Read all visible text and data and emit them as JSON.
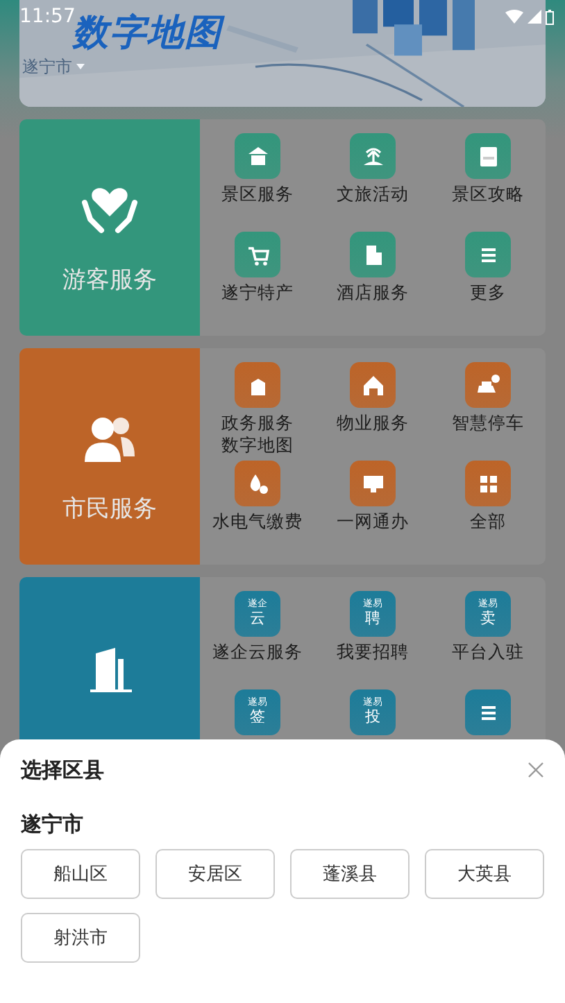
{
  "status_bar": {
    "time": "11:57"
  },
  "banner": {
    "title": "数字地图",
    "city": "遂宁市"
  },
  "sections": [
    {
      "title": "游客服务",
      "color": "#33967c",
      "tiles": [
        {
          "kind": "glyph",
          "label": "景区服务"
        },
        {
          "kind": "glyph",
          "label": "文旅活动"
        },
        {
          "kind": "glyph",
          "label": "景区攻略"
        },
        {
          "kind": "glyph",
          "label": "遂宁特产"
        },
        {
          "kind": "glyph",
          "label": "酒店服务"
        },
        {
          "kind": "glyph",
          "label": "更多"
        }
      ]
    },
    {
      "title": "市民服务",
      "color": "#bd6428",
      "tiles": [
        {
          "kind": "glyph",
          "label": "政务服务",
          "label_2": "数字地图"
        },
        {
          "kind": "glyph",
          "label": "物业服务"
        },
        {
          "kind": "glyph",
          "label": "智慧停车"
        },
        {
          "kind": "glyph",
          "label": "水电气缴费"
        },
        {
          "kind": "glyph",
          "label": "一网通办"
        },
        {
          "kind": "glyph",
          "label": "全部"
        }
      ]
    },
    {
      "color": "#1d7c99",
      "tiles": [
        {
          "kind": "text",
          "icon_text": [
            "遂企",
            "云"
          ],
          "label": "遂企云服务"
        },
        {
          "kind": "text",
          "icon_text": [
            "遂易",
            "聘"
          ],
          "label": "我要招聘"
        },
        {
          "kind": "text",
          "icon_text": [
            "遂易",
            "卖"
          ],
          "label": "平台入驻"
        },
        {
          "kind": "text",
          "icon_text": [
            "遂易",
            "签"
          ]
        },
        {
          "kind": "text",
          "icon_text": [
            "遂易",
            "投"
          ]
        },
        {
          "kind": "glyph"
        }
      ]
    }
  ],
  "sheet": {
    "title": "选择区县",
    "group": "遂宁市",
    "options": [
      "船山区",
      "安居区",
      "蓬溪县",
      "大英县",
      "射洪市"
    ]
  }
}
